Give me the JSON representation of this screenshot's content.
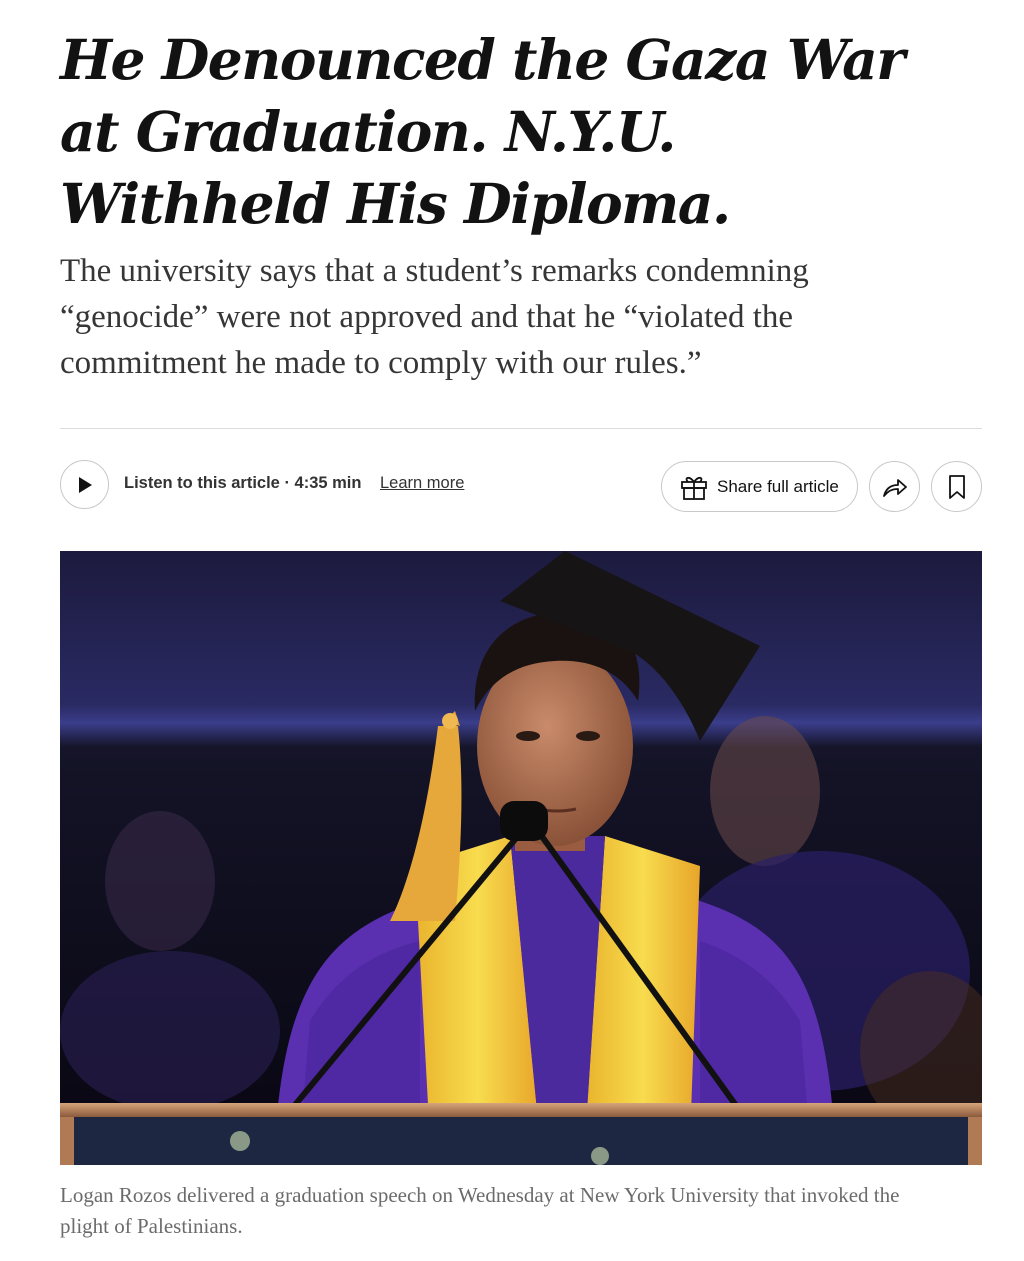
{
  "article": {
    "headline": "He Denounced the Gaza War at Graduation. N.Y.U. Withheld His Diploma.",
    "summary": "The university says that a student’s remarks condemning “genocide” were not approved and that he “violated the commitment he made to comply with our rules.”"
  },
  "toolbar": {
    "play_icon": "play-icon",
    "listen_text": "Listen to this article · 4:35 min",
    "learn_more": "Learn more",
    "share_label": "Share full article",
    "share_icon": "gift-icon",
    "forward_icon": "share-arrow-icon",
    "save_icon": "bookmark-icon"
  },
  "photo": {
    "caption": "Logan Rozos delivered a graduation speech on Wednesday at New York University that invoked the plight of Palestinians."
  },
  "colors": {
    "headline": "#121212",
    "summary": "#363636",
    "caption": "#6b6b6b",
    "gown": "#5a2fb0",
    "stole": "#f3c623"
  }
}
